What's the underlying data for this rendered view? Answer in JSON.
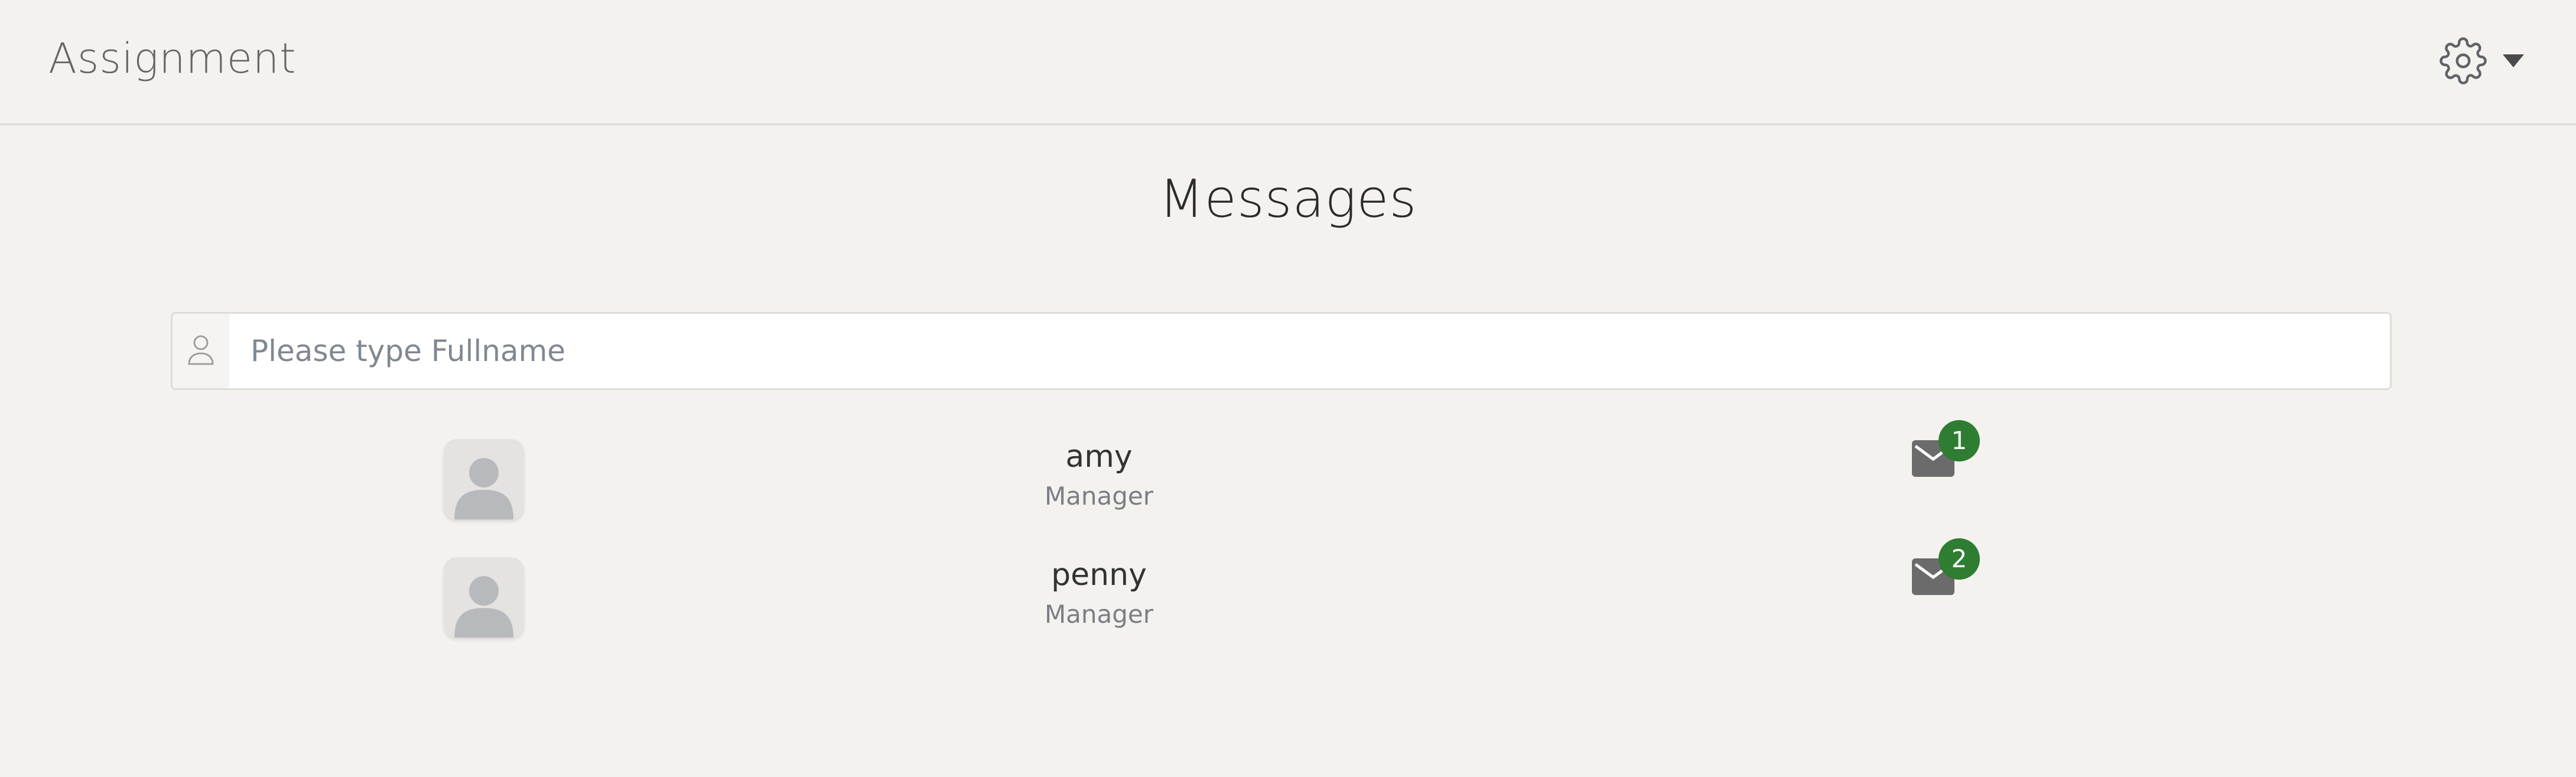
{
  "header": {
    "app_title": "Assignment",
    "settings_icon": "gear-icon",
    "dropdown_icon": "caret-down-icon"
  },
  "main": {
    "title": "Messages",
    "search": {
      "placeholder": "Please type Fullname",
      "value": "",
      "icon": "user-icon"
    },
    "contacts": [
      {
        "name": "amy",
        "role": "Manager",
        "unread": "1",
        "avatar_icon": "user-avatar-icon",
        "message_icon": "envelope-icon"
      },
      {
        "name": "penny",
        "role": "Manager",
        "unread": "2",
        "avatar_icon": "user-avatar-icon",
        "message_icon": "envelope-icon"
      }
    ]
  },
  "colors": {
    "background": "#f4f2ef",
    "badge": "#2e7d32",
    "envelope": "#6b6b6b",
    "avatar_bg": "#e4e3e1",
    "avatar_fg": "#b7b9bd"
  }
}
